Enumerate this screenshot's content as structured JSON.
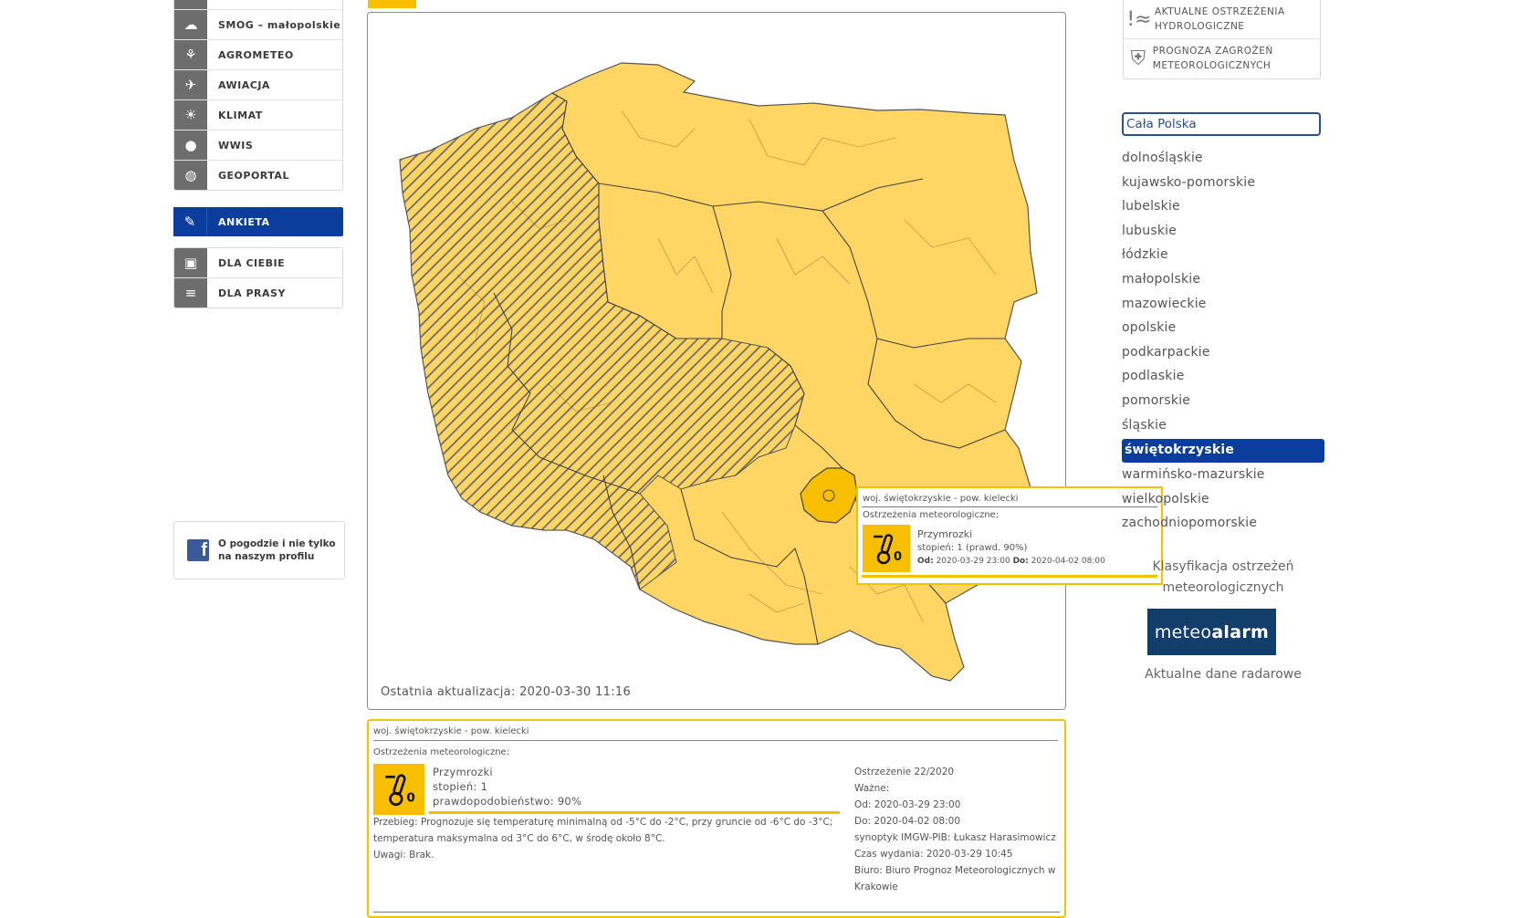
{
  "sidebar": {
    "items": [
      {
        "label": "SMOG – małopolskie",
        "icon": "smog-icon"
      },
      {
        "label": "AGROMETEO",
        "icon": "wheat-icon"
      },
      {
        "label": "AWIACJA",
        "icon": "plane-icon"
      },
      {
        "label": "KLIMAT",
        "icon": "sun-icon"
      },
      {
        "label": "WWIS",
        "icon": "globe-icon"
      },
      {
        "label": "GEOPORTAL",
        "icon": "geoportal-globe-icon"
      }
    ],
    "active_item": {
      "label": "ANKIETA",
      "icon": "survey-icon"
    },
    "extra_items": [
      {
        "label": "DLA CIEBIE",
        "icon": "gift-icon"
      },
      {
        "label": "DLA PRASY",
        "icon": "press-icon"
      }
    ],
    "facebook": {
      "text_line1": "O pogodzie i nie tylko",
      "text_line2": "na naszym profilu",
      "icon": "facebook-icon"
    }
  },
  "map": {
    "last_update": "Ostatnia aktualizacja: 2020-03-30 11:16",
    "fill_color": "#ffd564",
    "highlight_color": "#f7bf00",
    "tooltip": {
      "header": "woj. świętokrzyskie - pow. kielecki",
      "sub": "Ostrzeżenia meteorologiczne:",
      "name": "Przymrozki",
      "level": "stopień: 1 (prawd. 90%)",
      "from_label": "Od:",
      "from_value": "2020-03-29 23:00",
      "to_label": "Do:",
      "to_value": "2020-04-02 08:00"
    }
  },
  "detail": {
    "header": "woj. świętokrzyskie - pow. kielecki",
    "sub": "Ostrzeżenia meteorologiczne:",
    "name": "Przymrozki",
    "level": "stopień: 1",
    "probability": "prawdopodobieństwo: 90%",
    "course": "Przebieg: Prognozuje się temperaturę minimalną od -5°C do -2°C, przy gruncie od -6°C do -3°C; temperatura maksymalna od 3°C do 6°C, w środę około 8°C.",
    "remarks": "Uwagi: Brak.",
    "warning_no": "Ostrzeżenie 22/2020",
    "valid": "Ważne:",
    "from": "Od: 2020-03-29 23:00",
    "to": "Do: 2020-04-02 08:00",
    "forecaster": "synoptyk IMGW-PIB: Łukasz Harasimowicz",
    "issued": "Czas wydania: 2020-03-29 10:45",
    "office": "Biuro: Biuro Prognoz Meteorologicznych w Krakowie"
  },
  "right": {
    "hydro_warnings": "AKTUALNE OSTRZEŻENIA HYDROLOGICZNE",
    "meteo_threats": "PROGNOZA ZAGROŻEŃ METEOROLOGICZNYCH",
    "region_select": "Cała Polska",
    "regions": [
      "dolnośląskie",
      "kujawsko-pomorskie",
      "lubelskie",
      "lubuskie",
      "łódzkie",
      "małopolskie",
      "mazowieckie",
      "opolskie",
      "podkarpackie",
      "podlaskie",
      "pomorskie",
      "śląskie",
      "świętokrzyskie",
      "warmińsko-mazurskie",
      "wielkopolskie",
      "zachodniopomorskie"
    ],
    "active_region": "świętokrzyskie",
    "classification": "Klasyfikacja ostrzeżeń meteorologicznych",
    "meteoalarm_a": "meteo",
    "meteoalarm_b": "alarm",
    "radar": "Aktualne dane radarowe"
  }
}
